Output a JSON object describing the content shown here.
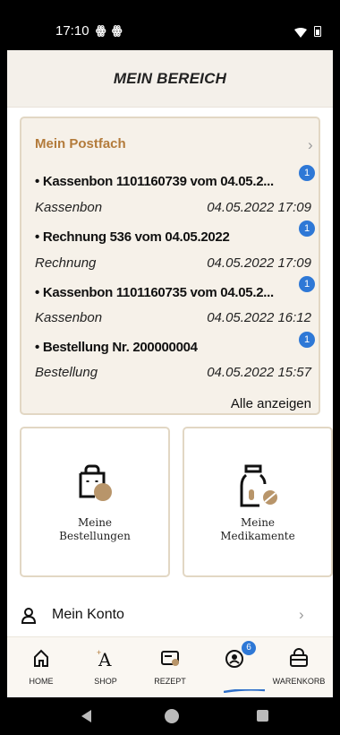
{
  "status_bar": {
    "time": "17:10",
    "notification_icons": [
      "ꙮ",
      "ꙮ"
    ],
    "wifi_icon": "wifi-icon",
    "battery_icon": "battery-icon"
  },
  "header": {
    "title": "MEIN BEREICH"
  },
  "mailbox": {
    "title": "Mein Postfach",
    "show_all": "Alle anzeigen",
    "messages": [
      {
        "title": "• Kassenbon 1101160739 vom 04.05.2...",
        "type": "Kassenbon",
        "date": "04.05.2022 17:09",
        "badge": "1"
      },
      {
        "title": "• Rechnung 536 vom 04.05.2022",
        "type": "Rechnung",
        "date": "04.05.2022 17:09",
        "badge": "1"
      },
      {
        "title": "• Kassenbon 1101160735 vom 04.05.2...",
        "type": "Kassenbon",
        "date": "04.05.2022 16:12",
        "badge": "1"
      },
      {
        "title": "• Bestellung Nr. 200000004",
        "type": "Bestellung",
        "date": "04.05.2022 15:57",
        "badge": "1"
      }
    ]
  },
  "tiles": {
    "orders": {
      "line1": "Meine",
      "line2": "Bestellungen",
      "icon": "shopping-bag-icon"
    },
    "medications": {
      "line1": "Meine",
      "line2": "Medikamente",
      "icon": "medicine-bottle-icon"
    }
  },
  "account": {
    "label": "Mein Konto",
    "icon": "person-icon"
  },
  "bottom_nav": {
    "items": [
      {
        "label": "HOME",
        "icon": "home-icon"
      },
      {
        "label": "SHOP",
        "icon": "shop-icon"
      },
      {
        "label": "REZEPT",
        "icon": "prescription-icon"
      },
      {
        "label": "",
        "icon": "account-icon",
        "badge": "6",
        "active": true
      },
      {
        "label": "WARENKORB",
        "icon": "basket-icon"
      }
    ]
  },
  "colors": {
    "accent_brown": "#b37b3b",
    "badge_blue": "#2e78d6",
    "card_background": "#f6f1e9",
    "card_border": "#e2d7c4",
    "header_background": "#f4f0ea"
  }
}
